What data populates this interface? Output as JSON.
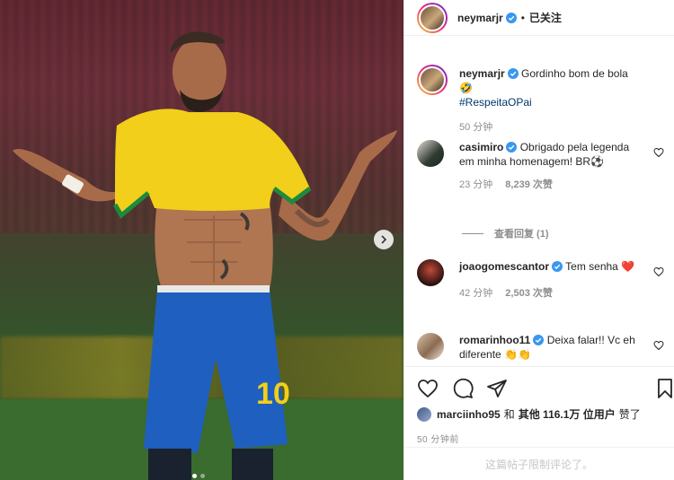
{
  "post": {
    "author": "neymarjr",
    "follow_label": "已关注",
    "separator": "•",
    "caption": {
      "text": "Gordinho bom de bola 🤣",
      "hashtag": "#RespeitaOPai",
      "time": "50 分钟"
    }
  },
  "comments": [
    {
      "username": "casimiro",
      "text": "Obrigado pela legenda em minha homenagem! BR⚽",
      "time": "23 分钟",
      "likes": "8,239 次赞",
      "view_replies": "查看回复 (1)"
    },
    {
      "username": "joaogomescantor",
      "text": "Tem senha ❤️",
      "time": "42 分钟",
      "likes": "2,503 次赞"
    },
    {
      "username": "romarinhoo11",
      "text": "Deixa falar!! Vc eh diferente 👏👏"
    }
  ],
  "likes_summary": {
    "first_liker": "marciinho95",
    "and": "和",
    "others": "其他 116.1万 位用户",
    "suffix": "赞了"
  },
  "posted_ago": "50 分钟前",
  "comments_limited": "这篇帖子限制评论了。",
  "colors": {
    "verified_blue": "#3897f0",
    "link_blue": "#00376b",
    "secondary_gray": "#8e8e8e",
    "jersey_yellow": "#f5d10a",
    "shorts_blue": "#1f5fbf"
  },
  "icons": {
    "like": "heart-icon",
    "comment": "comment-icon",
    "share": "paper-plane-icon",
    "save": "bookmark-icon",
    "next": "chevron-right-icon"
  },
  "carousel": {
    "slide_count": 2,
    "active_slide": 1
  }
}
